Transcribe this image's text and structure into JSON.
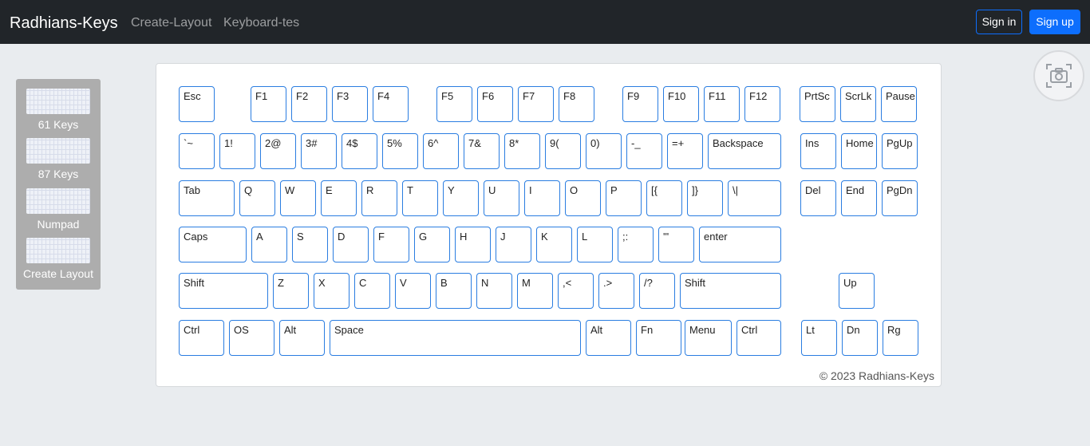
{
  "navbar": {
    "brand": "Radhians-Keys",
    "links": [
      "Create-Layout",
      "Keyboard-tes"
    ],
    "signin": "Sign in",
    "signup": "Sign up"
  },
  "sidebar": {
    "items": [
      {
        "label": "61 Keys"
      },
      {
        "label": "87 Keys"
      },
      {
        "label": "Numpad"
      },
      {
        "label": "Create Layout"
      }
    ]
  },
  "keyboard": {
    "rows": [
      [
        "Esc",
        "F1",
        "F2",
        "F3",
        "F4",
        "F5",
        "F6",
        "F7",
        "F8",
        "F9",
        "F10",
        "F11",
        "F12",
        "PrtSc",
        "ScrLk",
        "Pause"
      ],
      [
        "`~",
        "1!",
        "2@",
        "3#",
        "4$",
        "5%",
        "6^",
        "7&",
        "8*",
        "9(",
        "0)",
        "-_",
        "=+",
        "Backspace",
        "Ins",
        "Home",
        "PgUp"
      ],
      [
        "Tab",
        "Q",
        "W",
        "E",
        "R",
        "T",
        "Y",
        "U",
        "I",
        "O",
        "P",
        "[{",
        "]}",
        "\\|",
        "Del",
        "End",
        "PgDn"
      ],
      [
        "Caps",
        "A",
        "S",
        "D",
        "F",
        "G",
        "H",
        "J",
        "K",
        "L",
        ";:",
        "'\"",
        "enter"
      ],
      [
        "Shift",
        "Z",
        "X",
        "C",
        "V",
        "B",
        "N",
        "M",
        ",<",
        ".>",
        "/?",
        "Shift",
        "Up"
      ],
      [
        "Ctrl",
        "OS",
        "Alt",
        "Space",
        "Alt",
        "Fn",
        "Menu",
        "Ctrl",
        "Lt",
        "Dn",
        "Rg"
      ]
    ]
  },
  "footer": {
    "text": "© 2023 Radhians-Keys"
  },
  "colors": {
    "navbar": "#212529",
    "accent": "#0d6efd",
    "key_border": "#2a7de1",
    "page_bg": "#e9ecef"
  },
  "icons": {
    "screenshot": "camera-icon"
  }
}
